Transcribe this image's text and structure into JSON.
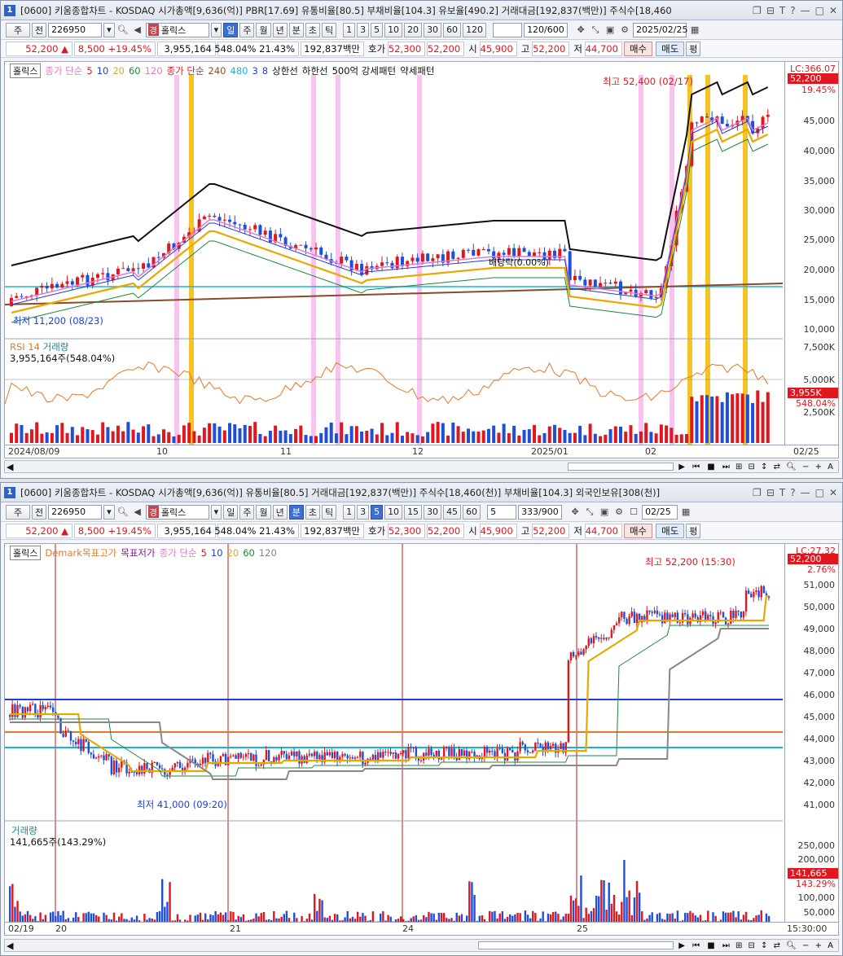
{
  "w1": {
    "window_no": "1",
    "title": "[0600] 키움종합차트 - KOSDAQ 시가총액[9,636(억)] PBR[17.69] 유통비율[80.5] 부채비율[104.3] 유보율[490.2] 거래대금[192,837(백만)] 주식수[18,460",
    "toolbar": {
      "type": "주",
      "prev": "전",
      "code": "226950",
      "indicator_badge": "경",
      "indicator": "홀릭스",
      "periods": [
        "일",
        "주",
        "월",
        "년",
        "분",
        "초",
        "틱"
      ],
      "selected_period": "일",
      "nums": [
        "1",
        "3",
        "5",
        "10",
        "20",
        "30",
        "60",
        "120"
      ],
      "count": "120/600",
      "date": "2025/02/25"
    },
    "info": {
      "price": "52,200",
      "arrow": "▲",
      "change": "8,500",
      "rate": "+19.45%",
      "volume": "3,955,164",
      "vol_rate": "548.04%",
      "turnover": "21.43%",
      "amount": "192,837백만",
      "quote_label": "호가",
      "ask": "52,300",
      "bid": "52,200",
      "open_label": "시",
      "open": "45,900",
      "high_label": "고",
      "high": "52,200",
      "low_label": "저",
      "low": "44,700",
      "buy": "매수",
      "sell": "매도",
      "avg": "평"
    },
    "legend": {
      "box": "홀릭스",
      "ma_label": "종가 단순",
      "ma": [
        "5",
        "10",
        "20",
        "60",
        "120"
      ],
      "ma_colors": [
        "#e0171f",
        "#1f3fd8",
        "#e8a800",
        "#1a8a3a",
        "#e07ad0"
      ],
      "ma2_label": "종가 단순",
      "ma2": [
        "240",
        "480",
        "3",
        "8"
      ],
      "upper": "상한선",
      "lower": "하한선",
      "pat": "500억 강세패턴",
      "weak": "약세패턴"
    },
    "y_labels": [
      "45,000",
      "40,000",
      "35,000",
      "30,000",
      "25,000",
      "20,000",
      "15,000",
      "10,000"
    ],
    "y_tags": {
      "lc": "LC:366.07",
      "price": "52,200",
      "pct": "19.45%"
    },
    "annotations": {
      "high": "최고 52,400 (02/17)",
      "low": "최저 11,200 (08/23)",
      "div": "배당락(0.00%)"
    },
    "sub": {
      "rsi": "RSI 14",
      "vol": "거래량",
      "vol_value": "3,955,164주(548.04%)",
      "y_labels": [
        "7,500K",
        "5,000K",
        "2,500K"
      ],
      "tag": "3,955K",
      "tag_pct": "548.04%"
    },
    "x_labels": [
      "2024/08/09",
      "10",
      "11",
      "12",
      "2025/01",
      "02",
      "02/25"
    ]
  },
  "w2": {
    "window_no": "1",
    "title": "[0600] 키움종합차트 - KOSDAQ 시가총액[9,636(억)] 유통비율[80.5] 거래대금[192,837(백만)] 주식수[18,460(천)] 부채비율[104.3] 외국인보유[308(천)]",
    "toolbar": {
      "type": "주",
      "prev": "전",
      "code": "226950",
      "indicator_badge": "경",
      "indicator": "홀릭스",
      "periods": [
        "일",
        "주",
        "월",
        "년",
        "분",
        "초",
        "틱"
      ],
      "selected_period": "분",
      "nums": [
        "1",
        "3",
        "5",
        "10",
        "15",
        "30",
        "45",
        "60"
      ],
      "selected_num": "5",
      "minute": "5",
      "count": "333/900",
      "date": "02/25"
    },
    "info": {
      "price": "52,200",
      "arrow": "▲",
      "change": "8,500",
      "rate": "+19.45%",
      "volume": "3,955,164",
      "vol_rate": "548.04%",
      "turnover": "21.43%",
      "amount": "192,837백만",
      "quote_label": "호가",
      "ask": "52,300",
      "bid": "52,200",
      "open_label": "시",
      "open": "45,900",
      "high_label": "고",
      "high": "52,200",
      "low_label": "저",
      "low": "44,700",
      "buy": "매수",
      "sell": "매도",
      "avg": "평"
    },
    "legend": {
      "box": "홀릭스",
      "demark_high": "Demark목표고가",
      "demark_low": "목표저가",
      "ma_label": "종가 단순",
      "ma": [
        "5",
        "10",
        "20",
        "60",
        "120"
      ]
    },
    "y_labels": [
      "51,000",
      "50,000",
      "49,000",
      "48,000",
      "47,000",
      "46,000",
      "45,000",
      "44,000",
      "43,000",
      "42,000",
      "41,000"
    ],
    "y_tags": {
      "lc": "LC:27.32",
      "price": "52,200",
      "pct": "2.76%"
    },
    "annotations": {
      "high": "최고 52,200 (15:30)",
      "low": "최저 41,000 (09:20)"
    },
    "sub": {
      "vol": "거래량",
      "vol_value": "141,665주(143.29%)",
      "y_labels": [
        "250,000",
        "200,000",
        "150,000",
        "100,000",
        "50,000"
      ],
      "tag": "141,665",
      "tag_pct": "143.29%"
    },
    "x_labels": [
      "02/19",
      "20",
      "21",
      "24",
      "25",
      "15:30:00"
    ]
  }
}
